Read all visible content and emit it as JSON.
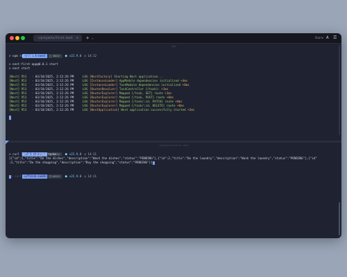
{
  "window": {
    "tab_title": "~/projects/first-nest",
    "share_label": "Share"
  },
  "colors": {
    "background": "#9aa6b8",
    "terminal_bg": "#1f2230",
    "log_green": "#9ece6a",
    "log_yellow": "#e0af68",
    "accent_blue": "#7aa2f7"
  },
  "pane1": {
    "title": "npm",
    "prompt": {
      "os": "",
      "dir": "~/first-nest",
      "git": " main",
      "node": "⬢ v22.9.0",
      "time": "◷ 14:12"
    },
    "command": "> npm run start",
    "script_lines": [
      "> nest-first-app@0.0.1 start",
      "> nest start"
    ],
    "logs": [
      {
        "prefix": "[Nest] 953   - ",
        "date": "03/18/2025, 2:12:26 PM",
        "level": "LOG",
        "ctx": "[NestFactory]",
        "msg": "Starting Nest application...",
        "extra": ""
      },
      {
        "prefix": "[Nest] 953   - ",
        "date": "03/18/2025, 2:12:26 PM",
        "level": "LOG",
        "ctx": "[InstanceLoader]",
        "msg": "AppModule dependencies initialized",
        "extra": "+4ms"
      },
      {
        "prefix": "[Nest] 953   - ",
        "date": "03/18/2025, 2:12:26 PM",
        "level": "LOG",
        "ctx": "[InstanceLoader]",
        "msg": "TaskModule dependencies initialized",
        "extra": "+0ms"
      },
      {
        "prefix": "[Nest] 953   - ",
        "date": "03/18/2025, 2:12:26 PM",
        "level": "LOG",
        "ctx": "[RoutesResolver]",
        "msg": "TaskController {/task}:",
        "extra": "+1ms"
      },
      {
        "prefix": "[Nest] 953   - ",
        "date": "03/18/2025, 2:12:26 PM",
        "level": "LOG",
        "ctx": "[RouterExplorer]",
        "msg": "Mapped {/task, GET} route",
        "extra": "+1ms"
      },
      {
        "prefix": "[Nest] 953   - ",
        "date": "03/18/2025, 2:12:26 PM",
        "level": "LOG",
        "ctx": "[RouterExplorer]",
        "msg": "Mapped {/task, POST} route",
        "extra": "+0ms"
      },
      {
        "prefix": "[Nest] 953   - ",
        "date": "03/18/2025, 2:12:26 PM",
        "level": "LOG",
        "ctx": "[RouterExplorer]",
        "msg": "Mapped {/task/:id, PATCH} route",
        "extra": "+0ms"
      },
      {
        "prefix": "[Nest] 953   - ",
        "date": "03/18/2025, 2:12:26 PM",
        "level": "LOG",
        "ctx": "[RouterExplorer]",
        "msg": "Mapped {/task/:id, DELETE} route",
        "extra": "+0ms"
      },
      {
        "prefix": "[Nest] 953   - ",
        "date": "03/18/2025, 2:12:26 PM",
        "level": "LOG",
        "ctx": "[NestApplication]",
        "msg": "Nest application successfully started",
        "extra": "+2ms"
      }
    ]
  },
  "pane2": {
    "title": "~/projects/first-nest",
    "prompt1": {
      "os": "",
      "dir": "~/first-nest",
      "git": " main",
      "node": "⬢ v22.9.0",
      "time": "◷ 14:11"
    },
    "command": "> curl 127.0.0.1:3000/task/",
    "output_line1": "[{\"id\":1,\"title\":\"Do the dishes\",\"description\":\"Wash the dishes\",\"status\":\"PENDING\"},{\"id\":2,\"title\":\"Do the laundry\",\"description\":\"Wash the laundry\",\"status\":\"PENDING\"},{\"id\"",
    "output_line2": ":3,\"title\":\"Do the shopping\",\"description\":\"Buy the shopping\",\"status\":\"PENDING\"}]",
    "prompt2": {
      "os": "",
      "dir": "~/first-nest",
      "git": " main",
      "node": "⬢ v22.9.0",
      "time": "◷ 14:11"
    },
    "suggestion": "> curl 127.0.0.1:3000/task/"
  }
}
